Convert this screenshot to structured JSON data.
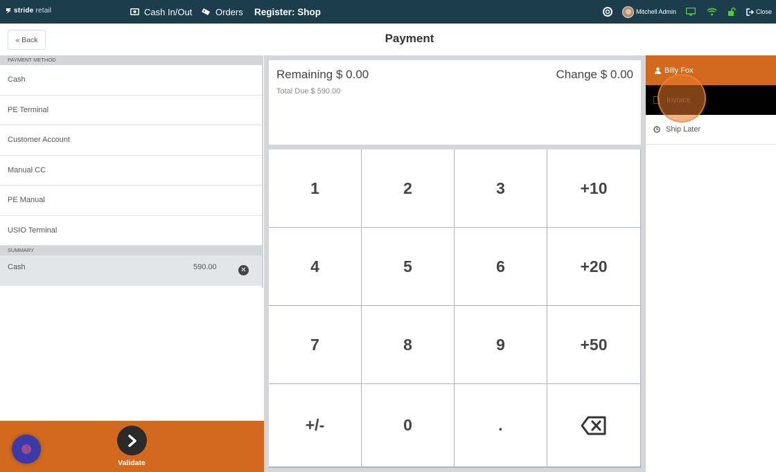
{
  "topbar": {
    "logo_bold": "stride",
    "logo_light": "retail",
    "cash_in_out": "Cash In/Out",
    "orders": "Orders",
    "register": "Register: Shop",
    "user": "Mitchell Admin",
    "close": "Close"
  },
  "header": {
    "back": "« Back",
    "title": "Payment"
  },
  "payment_methods": {
    "heading": "PAYMENT METHOD",
    "items": [
      "Cash",
      "PE Terminal",
      "Customer Account",
      "Manual CC",
      "PE Manual",
      "USIO Terminal"
    ]
  },
  "summary": {
    "heading": "SUMMARY",
    "lines": [
      {
        "name": "Cash",
        "amount": "590.00"
      }
    ]
  },
  "totals": {
    "remaining": "Remaining $ 0.00",
    "change": "Change $ 0.00",
    "total_due": "Total Due  $ 590.00"
  },
  "numpad": {
    "keys": [
      "1",
      "2",
      "3",
      "+10",
      "4",
      "5",
      "6",
      "+20",
      "7",
      "8",
      "9",
      "+50",
      "+/-",
      "0",
      "."
    ]
  },
  "validate": {
    "label": "Validate"
  },
  "right_panel": {
    "customer": "Billy Fox",
    "invoice": "Invoice",
    "ship_later": "Ship Later"
  },
  "colors": {
    "topbar": "#1c3d4c",
    "accent": "#d2691e",
    "panel_gray": "#d3d7dc"
  }
}
